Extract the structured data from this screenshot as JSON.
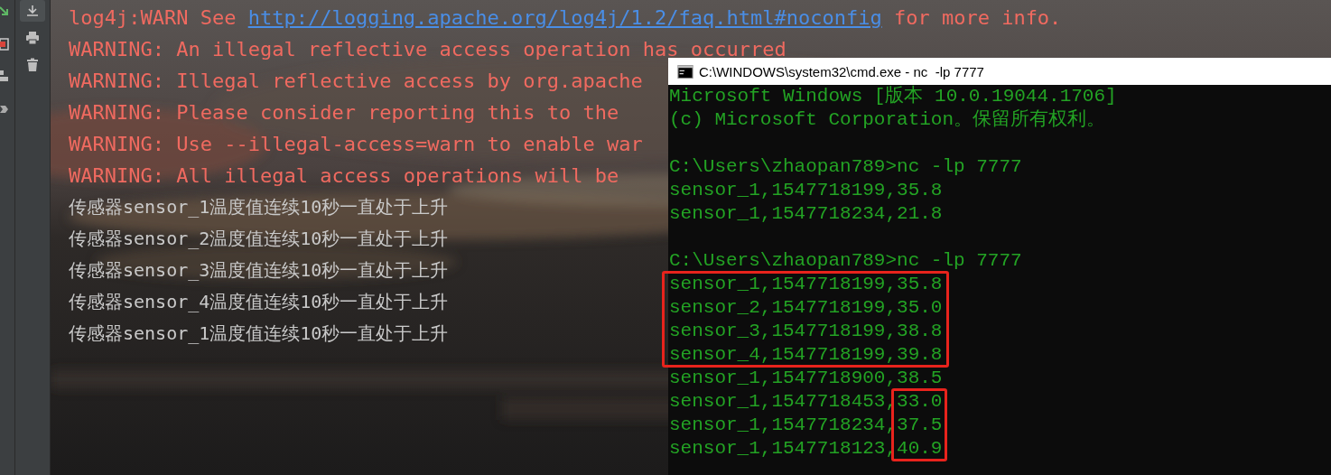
{
  "console": {
    "lines": [
      {
        "kind": "warn",
        "parts": [
          {
            "kind": "text",
            "text": "log4j:WARN See "
          },
          {
            "kind": "link",
            "text": "http://logging.apache.org/log4j/1.2/faq.html#noconfig"
          },
          {
            "kind": "text",
            "text": " for more info."
          }
        ]
      },
      {
        "kind": "warn",
        "parts": [
          {
            "kind": "text",
            "text": "WARNING: An illegal reflective access operation has occurred"
          }
        ]
      },
      {
        "kind": "warn",
        "parts": [
          {
            "kind": "text",
            "text": "WARNING: Illegal reflective access by org.apache"
          }
        ]
      },
      {
        "kind": "warn",
        "parts": [
          {
            "kind": "text",
            "text": "WARNING: Please consider reporting this to the"
          }
        ]
      },
      {
        "kind": "warn",
        "parts": [
          {
            "kind": "text",
            "text": "WARNING: Use --illegal-access=warn to enable war"
          }
        ]
      },
      {
        "kind": "warn",
        "parts": [
          {
            "kind": "text",
            "text": "WARNING: All illegal access operations will be"
          }
        ]
      },
      {
        "kind": "info",
        "parts": [
          {
            "kind": "text",
            "text": "传感器sensor_1温度值连续10秒一直处于上升"
          }
        ]
      },
      {
        "kind": "info",
        "parts": [
          {
            "kind": "text",
            "text": "传感器sensor_2温度值连续10秒一直处于上升"
          }
        ]
      },
      {
        "kind": "info",
        "parts": [
          {
            "kind": "text",
            "text": "传感器sensor_3温度值连续10秒一直处于上升"
          }
        ]
      },
      {
        "kind": "info",
        "parts": [
          {
            "kind": "text",
            "text": "传感器sensor_4温度值连续10秒一直处于上升"
          }
        ]
      },
      {
        "kind": "info",
        "parts": [
          {
            "kind": "text",
            "text": "传感器sensor_1温度值连续10秒一直处于上升"
          }
        ]
      }
    ]
  },
  "cmd": {
    "title": "C:\\WINDOWS\\system32\\cmd.exe - nc  -lp 7777",
    "lines": [
      {
        "kind": "text",
        "text": "Microsoft Windows [版本 10.0.19044.1706]",
        "boxed": false
      },
      {
        "kind": "text",
        "text": "(c) Microsoft Corporation。保留所有权利。",
        "boxed": false
      },
      {
        "kind": "blank"
      },
      {
        "kind": "text",
        "text": "C:\\Users\\zhaopan789>nc -lp 7777",
        "boxed": false
      },
      {
        "kind": "text",
        "text": "sensor_1,1547718199,35.8",
        "boxed": false
      },
      {
        "kind": "text",
        "text": "sensor_1,1547718234,21.8",
        "boxed": false
      },
      {
        "kind": "blank"
      },
      {
        "kind": "text",
        "text": "C:\\Users\\zhaopan789>nc -lp 7777",
        "boxed": false
      },
      {
        "kind": "text",
        "text": "sensor_1,1547718199,35.8",
        "boxed": true
      },
      {
        "kind": "text",
        "text": "sensor_2,1547718199,35.0",
        "boxed": true
      },
      {
        "kind": "text",
        "text": "sensor_3,1547718199,38.8",
        "boxed": true
      },
      {
        "kind": "text",
        "text": "sensor_4,1547718199,39.8",
        "boxed": true
      },
      {
        "kind": "text",
        "text": "sensor_1,1547718900,38.5",
        "boxed": false
      },
      {
        "kind": "text",
        "text": "sensor_1,1547718453,",
        "tail": "33.0",
        "boxed": true
      },
      {
        "kind": "text",
        "text": "sensor_1,1547718234,",
        "tail": "37.5",
        "boxed": true
      },
      {
        "kind": "text",
        "text": "sensor_1,1547718123,",
        "tail": "40.9",
        "boxed": true
      }
    ]
  }
}
